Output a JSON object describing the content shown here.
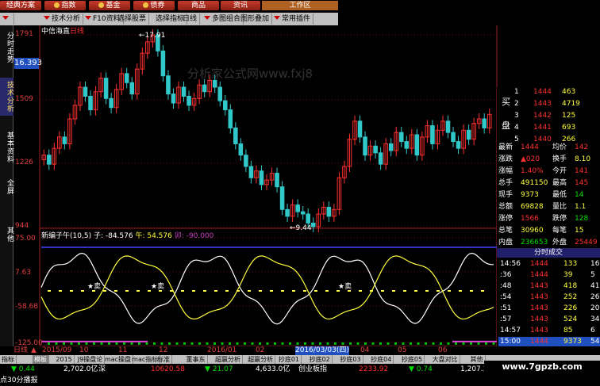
{
  "menu": {
    "items": [
      "经典方案",
      "指数",
      "基金",
      "债券",
      "商品",
      "资讯"
    ],
    "workarea": "工作区"
  },
  "toolbar": {
    "items": [
      "技术分析",
      "F10资料",
      "选择股票",
      "选择指标",
      "日线",
      "多图组合",
      "图形叠加",
      "常用插件"
    ]
  },
  "lefttabs": [
    "分时走势",
    "技术分析",
    "基本资料",
    "全屏",
    "其他"
  ],
  "chart": {
    "stock_title": "中信海直",
    "period": "日线",
    "price_ticks": [
      "1791",
      "1509",
      "1226",
      "944"
    ],
    "current_price": "16.393",
    "high_label": "17.91",
    "low_label": "9.44",
    "watermark": "分析家公式网www.fxj8"
  },
  "indicator": {
    "name": "新编子午",
    "params": "(10,5)",
    "zi_label": "子: -84.576",
    "wu_label": "午: 54.576",
    "mao_label": "卯: -90.000",
    "ticks": [
      "75.00",
      "7.63",
      "-58.68",
      "-125.00"
    ],
    "markers": [
      "卖",
      "卖",
      "卖"
    ]
  },
  "chart_data": {
    "type": "line",
    "title": "中信海直 日线",
    "ylim": [
      9.44,
      17.91
    ],
    "series": [
      {
        "name": "子",
        "values": [
          -84.576
        ]
      },
      {
        "name": "午",
        "values": [
          54.576
        ]
      },
      {
        "name": "卯",
        "values": [
          -90.0
        ]
      }
    ]
  },
  "orderbook": {
    "buy_label": "买",
    "pan_label": "盘",
    "rows": [
      {
        "lvl": "1",
        "price": "1444",
        "vol": "463"
      },
      {
        "lvl": "2",
        "price": "1443",
        "vol": "4719"
      },
      {
        "lvl": "3",
        "price": "1442",
        "vol": "125"
      },
      {
        "lvl": "4",
        "price": "1441",
        "vol": "693"
      },
      {
        "lvl": "5",
        "price": "1440",
        "vol": "266"
      }
    ]
  },
  "quote": {
    "rows": [
      {
        "k1": "最新",
        "v1": "1444",
        "k2": "均价",
        "v2": "142"
      },
      {
        "k1": "涨跌",
        "v1": "▲020",
        "k2": "换手",
        "v2": "8.10"
      },
      {
        "k1": "涨幅",
        "v1": "1.40%",
        "k2": "今开",
        "v2": "141"
      },
      {
        "k1": "总手",
        "v1": "491150",
        "k2": "最高",
        "v2": "145"
      },
      {
        "k1": "现手",
        "v1": "9373",
        "k2": "最低",
        "v2": "14"
      },
      {
        "k1": "总额",
        "v1": "69828",
        "k2": "量比",
        "v2": "1.1"
      },
      {
        "k1": "涨停",
        "v1": "1566",
        "k2": "跌停",
        "v2": "128"
      },
      {
        "k1": "总笔",
        "v1": "30960",
        "k2": "每笔",
        "v2": "15"
      },
      {
        "k1": "内盘",
        "v1": "236653",
        "k2": "外盘",
        "v2": "25449"
      }
    ]
  },
  "ticks": {
    "header": "分时成交",
    "rows": [
      {
        "t": "14:56",
        "p": "1444",
        "v": "133",
        "n": "16"
      },
      {
        "t": ":36",
        "p": "1444",
        "v": "39",
        "n": "5"
      },
      {
        "t": ":48",
        "p": "1443",
        "v": "418",
        "n": "41"
      },
      {
        "t": ":54",
        "p": "1443",
        "v": "252",
        "n": "26"
      },
      {
        "t": ":51",
        "p": "1443",
        "v": "226",
        "n": "20"
      },
      {
        "t": ":57",
        "p": "1443",
        "v": "524",
        "n": "34"
      },
      {
        "t": "14:57",
        "p": "1443",
        "v": "85",
        "n": "6"
      },
      {
        "t": "15:00",
        "p": "1444",
        "v": "9373",
        "n": "542"
      }
    ]
  },
  "datebar": {
    "period": "日线",
    "labels": [
      "2015/09",
      "10",
      "11",
      "12",
      "2016/01",
      "02",
      "2016/03/03(四)",
      "04",
      "05",
      "06"
    ]
  },
  "bottomtabs": [
    "指标",
    "模板",
    "2015",
    "J9操盘论",
    "mac操盘",
    "mac指标",
    "标准",
    "董事东",
    "超赢分析",
    "超赢分析",
    "抄底01",
    "抄底02",
    "抄底03",
    "抄底04",
    "抄底05",
    "大盘对比",
    "其他"
  ],
  "status": {
    "s1": "0.44",
    "s2": "2,702.0亿",
    "s3": "深",
    "s4": "10620.58",
    "s5": "21.07",
    "s6": "4,633.0亿",
    "s7": "创业板指",
    "s8": "2233.92",
    "s9": "0.74",
    "s10": "1,207.3",
    "s11": "点30分播报",
    "site": "www.7gpzb.com"
  }
}
